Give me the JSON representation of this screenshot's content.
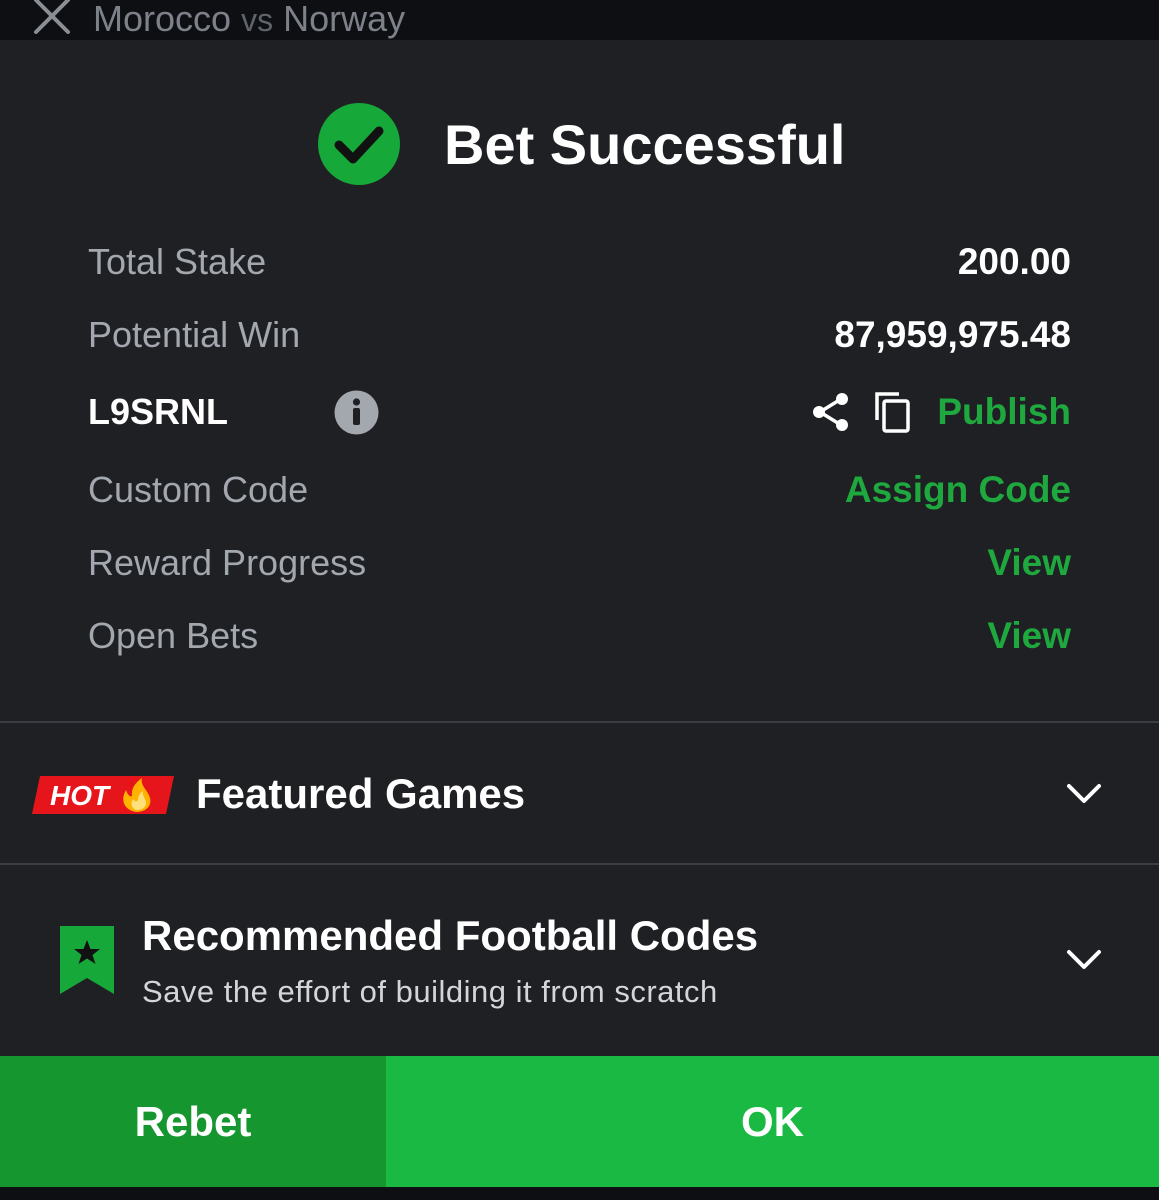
{
  "colors": {
    "background": "#1e2024",
    "accent_green": "#1fa83e",
    "success_green": "#17a83a",
    "hot_red": "#e5151b",
    "ok_button": "#1ab944",
    "rebet_button": "#16962f"
  },
  "topbar": {
    "close_icon": "close-icon",
    "home_team": "Morocco",
    "vs": "vs",
    "away_team": "Norway"
  },
  "header": {
    "icon": "check-circle-icon",
    "title": "Bet Successful"
  },
  "details": {
    "total_stake_label": "Total Stake",
    "total_stake_value": "200.00",
    "potential_win_label": "Potential Win",
    "potential_win_value": "87,959,975.48",
    "booking_code": "L9SRNL",
    "publish_label": "Publish",
    "custom_code_label": "Custom Code",
    "assign_code_label": "Assign Code",
    "reward_progress_label": "Reward Progress",
    "reward_progress_link": "View",
    "open_bets_label": "Open Bets",
    "open_bets_link": "View"
  },
  "featured": {
    "badge_text": "HOT",
    "title": "Featured Games"
  },
  "recommended": {
    "title": "Recommended Football Codes",
    "subtitle": "Save the effort of building it from scratch"
  },
  "buttons": {
    "rebet": "Rebet",
    "ok": "OK"
  }
}
